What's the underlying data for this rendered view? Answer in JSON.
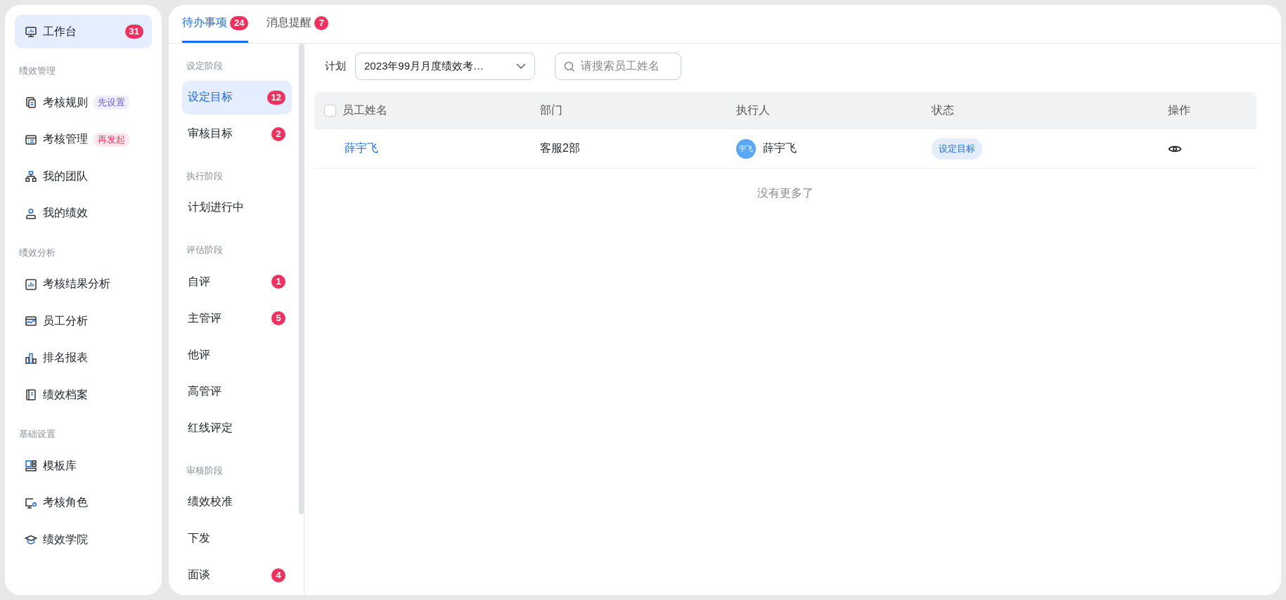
{
  "sidebar": {
    "items": [
      {
        "kind": "item",
        "label": "工作台",
        "selected": true,
        "badge": "31"
      },
      {
        "kind": "heading",
        "label": "绩效管理"
      },
      {
        "kind": "item",
        "label": "考核规则",
        "selected": false,
        "tag": {
          "text": "先设置",
          "color": "#6a5df2"
        }
      },
      {
        "kind": "item",
        "label": "考核管理",
        "selected": false,
        "tag": {
          "text": "再发起",
          "color": "#f0335f"
        }
      },
      {
        "kind": "item",
        "label": "我的团队",
        "selected": false
      },
      {
        "kind": "item",
        "label": "我的绩效",
        "selected": false
      },
      {
        "kind": "heading",
        "label": "绩效分析"
      },
      {
        "kind": "item",
        "label": "考核结果分析",
        "selected": false
      },
      {
        "kind": "item",
        "label": "员工分析",
        "selected": false
      },
      {
        "kind": "item",
        "label": "排名报表",
        "selected": false
      },
      {
        "kind": "item",
        "label": "绩效档案",
        "selected": false
      },
      {
        "kind": "heading",
        "label": "基础设置"
      },
      {
        "kind": "item",
        "label": "模板库",
        "selected": false
      },
      {
        "kind": "item",
        "label": "考核角色",
        "selected": false
      },
      {
        "kind": "item",
        "label": "绩效学院",
        "selected": false
      }
    ]
  },
  "tabs": [
    {
      "label": "待办事项",
      "badge": "24",
      "selected": true
    },
    {
      "label": "消息提醒",
      "badge": "7",
      "selected": false
    }
  ],
  "stage_menu": {
    "items": [
      {
        "kind": "heading",
        "label": "设定阶段"
      },
      {
        "kind": "item",
        "label": "设定目标",
        "selected": true,
        "badge": "12"
      },
      {
        "kind": "item",
        "label": "审核目标",
        "selected": false,
        "badge": "2"
      },
      {
        "kind": "heading",
        "label": "执行阶段"
      },
      {
        "kind": "item",
        "label": "计划进行中",
        "selected": false
      },
      {
        "kind": "heading",
        "label": "评估阶段"
      },
      {
        "kind": "item",
        "label": "自评",
        "selected": false,
        "badge": "1"
      },
      {
        "kind": "item",
        "label": "主管评",
        "selected": false,
        "badge": "5"
      },
      {
        "kind": "item",
        "label": "他评",
        "selected": false
      },
      {
        "kind": "item",
        "label": "高管评",
        "selected": false
      },
      {
        "kind": "item",
        "label": "红线评定",
        "selected": false
      },
      {
        "kind": "heading",
        "label": "审核阶段"
      },
      {
        "kind": "item",
        "label": "绩效校准",
        "selected": false
      },
      {
        "kind": "item",
        "label": "下发",
        "selected": false
      },
      {
        "kind": "item",
        "label": "面谈",
        "selected": false,
        "badge": "4"
      }
    ]
  },
  "filter": {
    "label": "计划",
    "plan": "2023年99月月度绩效考…",
    "search_placeholder": "请搜索员工姓名"
  },
  "table": {
    "header_checked": false,
    "columns": [
      "员工姓名",
      "部门",
      "执行人",
      "状态",
      "操作"
    ],
    "rows": [
      {
        "name": "薛宇飞",
        "department": "客服2部",
        "executor": {
          "avatar_text": "宇飞",
          "name": "薛宇飞"
        },
        "status": "设定目标"
      }
    ],
    "empty_text": "没有更多了"
  }
}
